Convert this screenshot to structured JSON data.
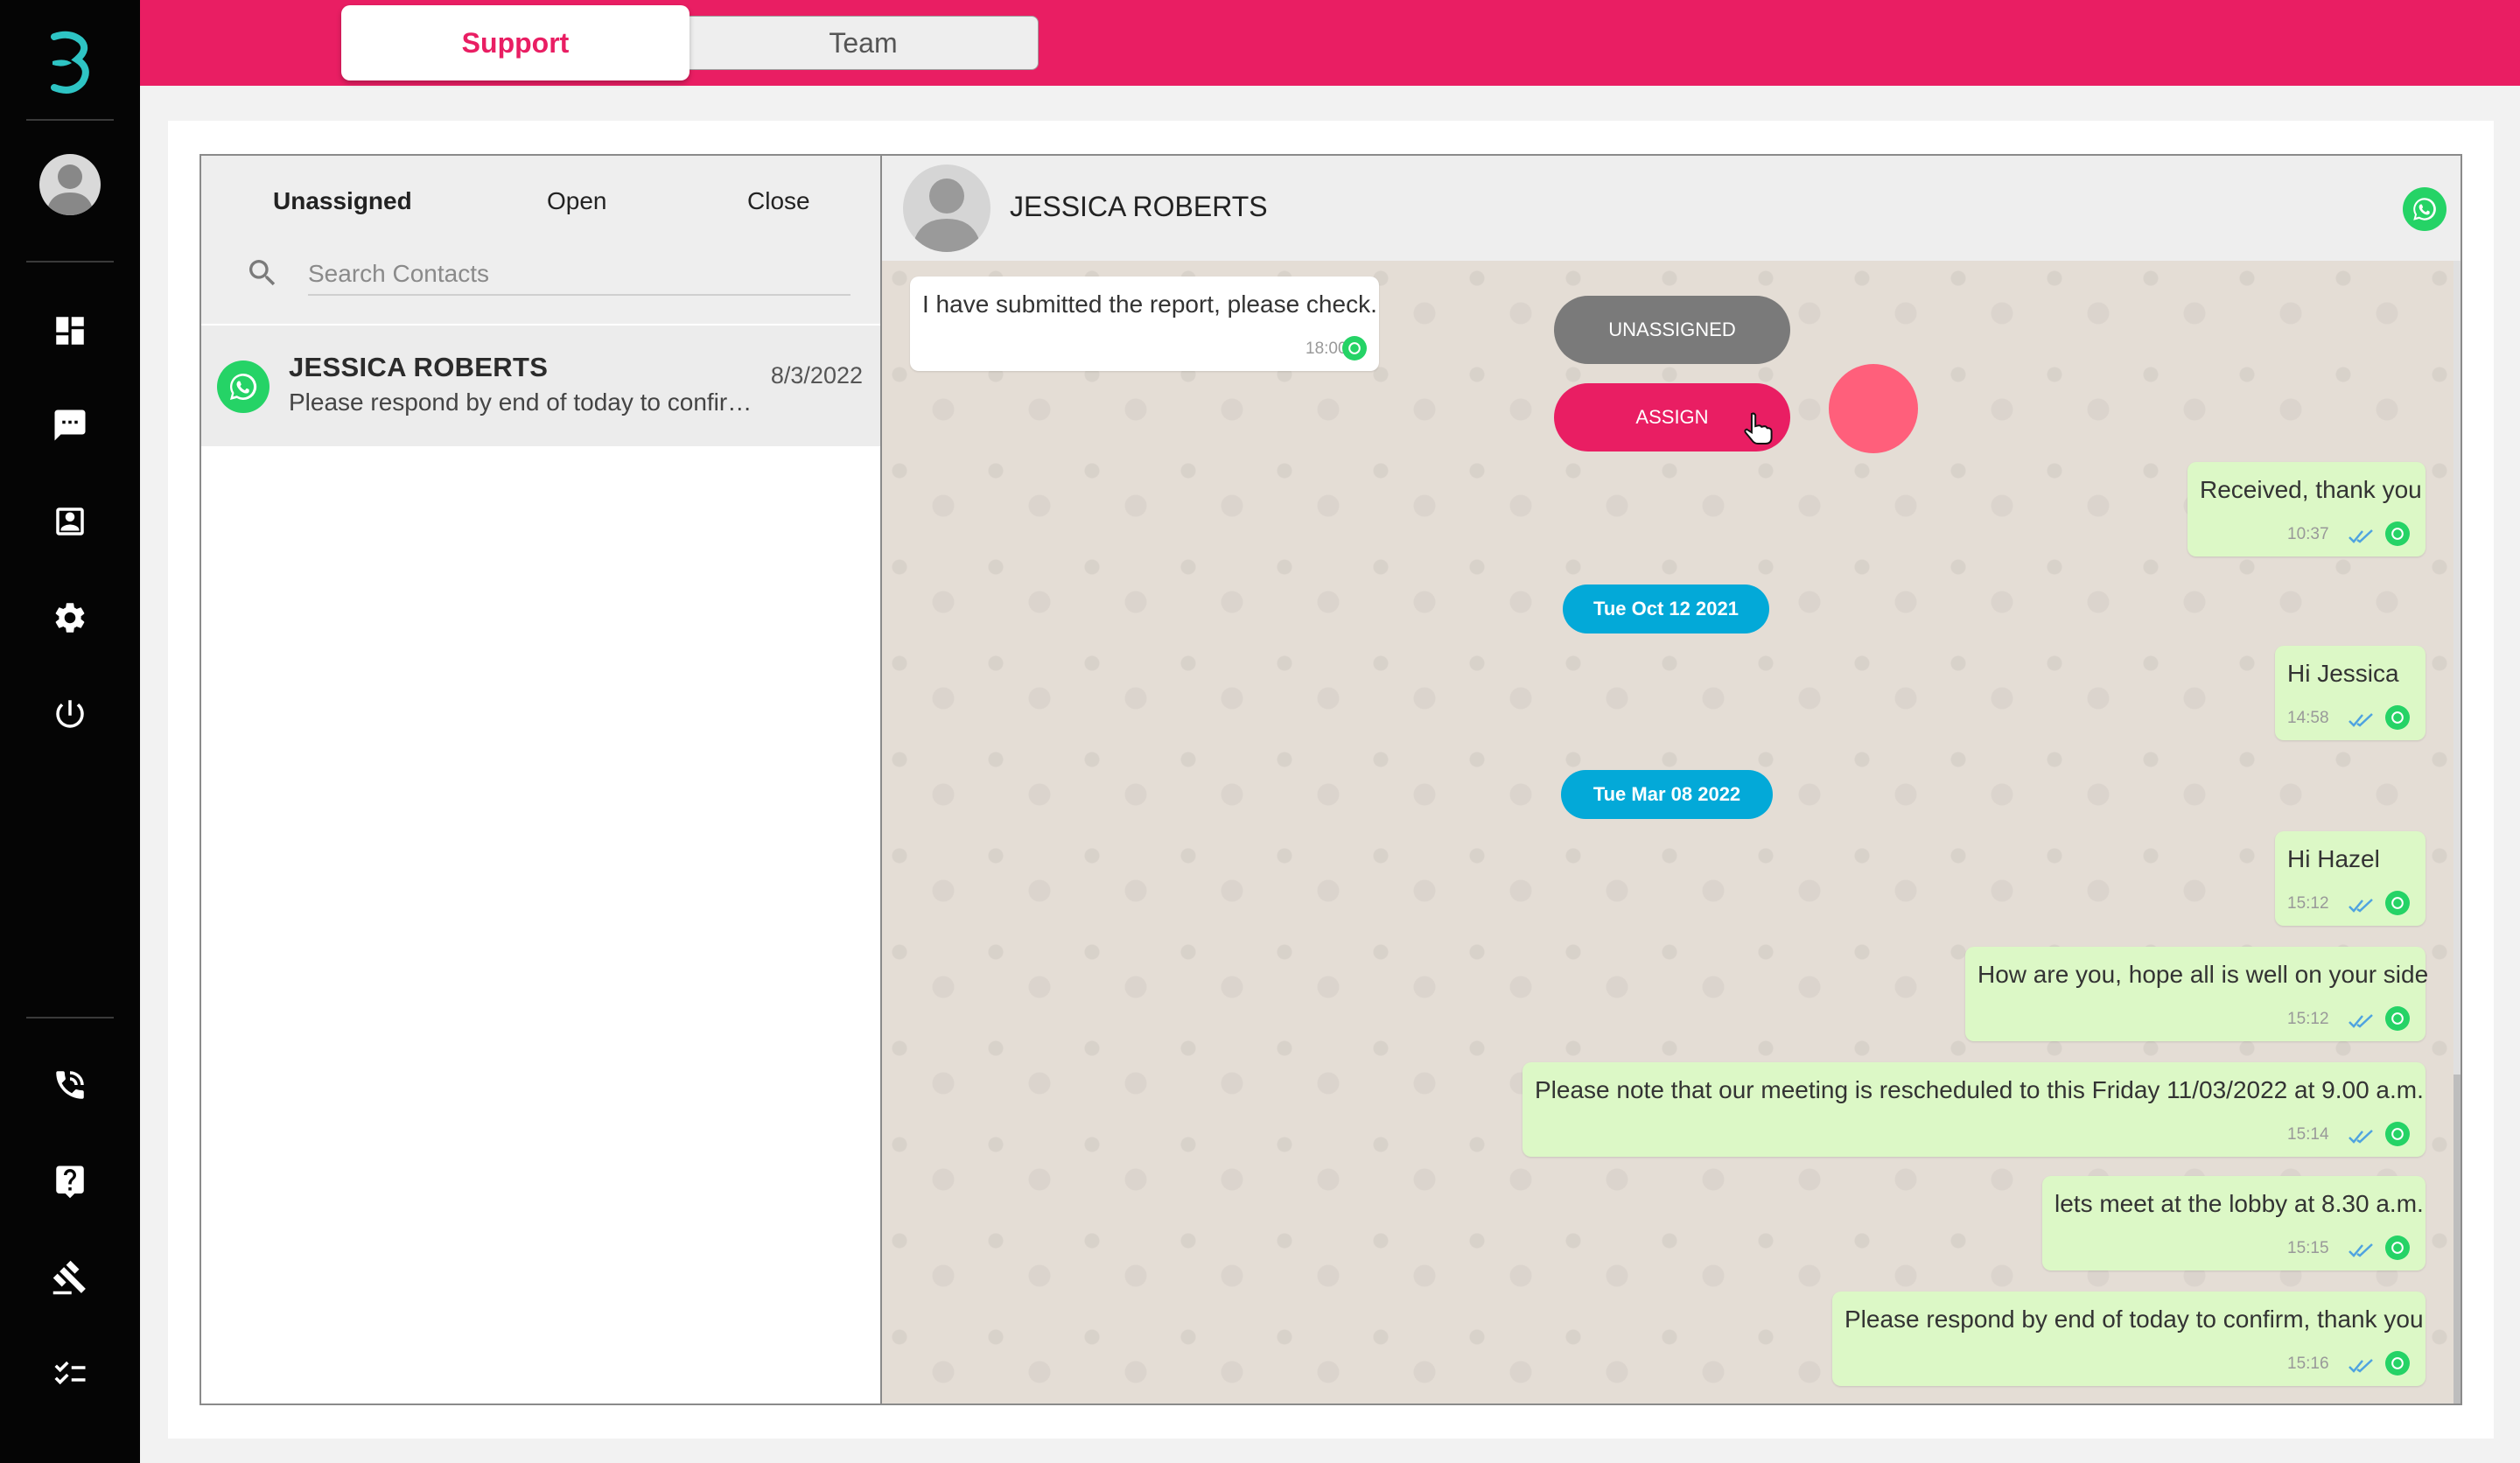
{
  "colors": {
    "brand": "#e91e63",
    "rail": "#050505",
    "whatsapp": "#25d366",
    "date_chip": "#03a9d8",
    "out_bubble": "#dcf8c6"
  },
  "topbar": {
    "tabs": [
      {
        "label": "Support",
        "active": true
      },
      {
        "label": "Team",
        "active": false
      }
    ]
  },
  "rail": {
    "icons": [
      "logo-icon",
      "avatar",
      "dashboard-icon",
      "chat-icon",
      "contacts-icon",
      "settings-icon",
      "power-icon",
      "phone-transfer-icon",
      "help-icon",
      "gavel-icon",
      "checklist-icon"
    ]
  },
  "contacts_panel": {
    "tabs": [
      "Unassigned",
      "Open",
      "Close"
    ],
    "active_tab": "Unassigned",
    "search_placeholder": "Search Contacts",
    "items": [
      {
        "name": "JESSICA ROBERTS",
        "preview": "Please respond by end of today to confirm, thank you",
        "date": "8/3/2022",
        "channel": "whatsapp"
      }
    ]
  },
  "chat": {
    "contact_name": "JESSICA ROBERTS",
    "channel_icon": "whatsapp-icon",
    "actions": {
      "unassigned_label": "UNASSIGNED",
      "assign_label": "ASSIGN"
    },
    "messages": [
      {
        "direction": "in",
        "text": "I have submitted the report, please check.",
        "time": "18:00"
      },
      {
        "direction": "out",
        "text": "Received, thank you",
        "time": "10:37"
      },
      {
        "type": "date",
        "text": "Tue Oct 12 2021"
      },
      {
        "direction": "out",
        "text": "Hi Jessica",
        "time": "14:58"
      },
      {
        "type": "date",
        "text": "Tue Mar 08 2022"
      },
      {
        "direction": "out",
        "text": "Hi Hazel",
        "time": "15:12"
      },
      {
        "direction": "out",
        "text": "How are you, hope all is well on your side",
        "time": "15:12"
      },
      {
        "direction": "out",
        "text": "Please note that our meeting is rescheduled to this Friday 11/03/2022 at 9.00 a.m.",
        "time": "15:14"
      },
      {
        "direction": "out",
        "text": "lets meet at the lobby at 8.30 a.m.",
        "time": "15:15"
      },
      {
        "direction": "out",
        "text": "Please respond by end of today to confirm, thank you",
        "time": "15:16"
      }
    ]
  }
}
